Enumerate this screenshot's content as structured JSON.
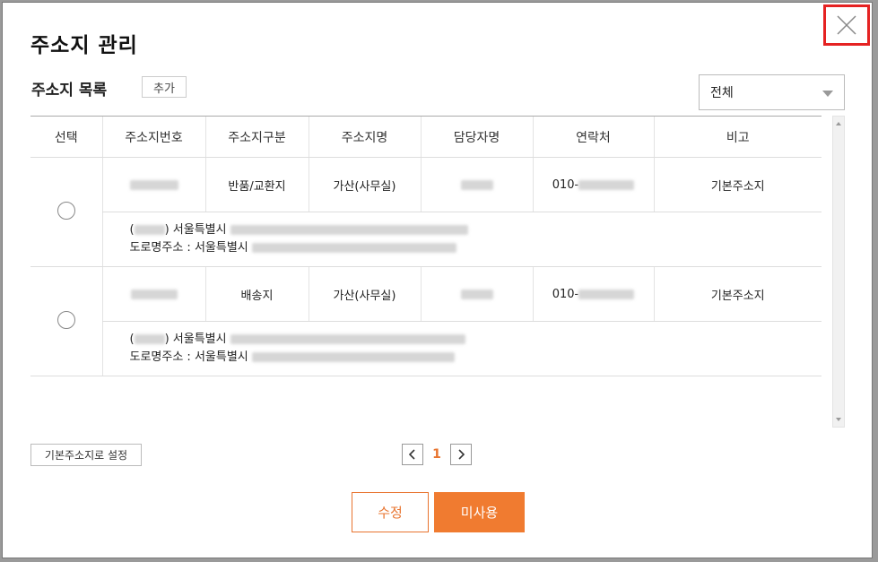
{
  "modal": {
    "title": "주소지 관리",
    "close_icon": "close-icon"
  },
  "list": {
    "subtitle": "주소지 목록",
    "add_label": "추가",
    "filter_value": "전체"
  },
  "table": {
    "headers": [
      "선택",
      "주소지번호",
      "주소지구분",
      "주소지명",
      "담당자명",
      "연락처",
      "비고"
    ],
    "rows": [
      {
        "type": "반품/교환지",
        "name": "가산(사무실)",
        "phone_prefix": "010-",
        "note": "기본주소지",
        "addr_paren_open": "(",
        "addr_line1_prefix": ") 서울특별시",
        "addr_line2_prefix": "도로명주소 : 서울특별시"
      },
      {
        "type": "배송지",
        "name": "가산(사무실)",
        "phone_prefix": "010-",
        "note": "기본주소지",
        "addr_paren_open": "(",
        "addr_line1_prefix": ") 서울특별시",
        "addr_line2_prefix": "도로명주소 : 서울특별시"
      }
    ]
  },
  "footer": {
    "set_default_label": "기본주소지로 설정",
    "current_page": "1",
    "edit_label": "수정",
    "disable_label": "미사용"
  },
  "colors": {
    "accent": "#f07b30",
    "close_border": "#e52222"
  }
}
